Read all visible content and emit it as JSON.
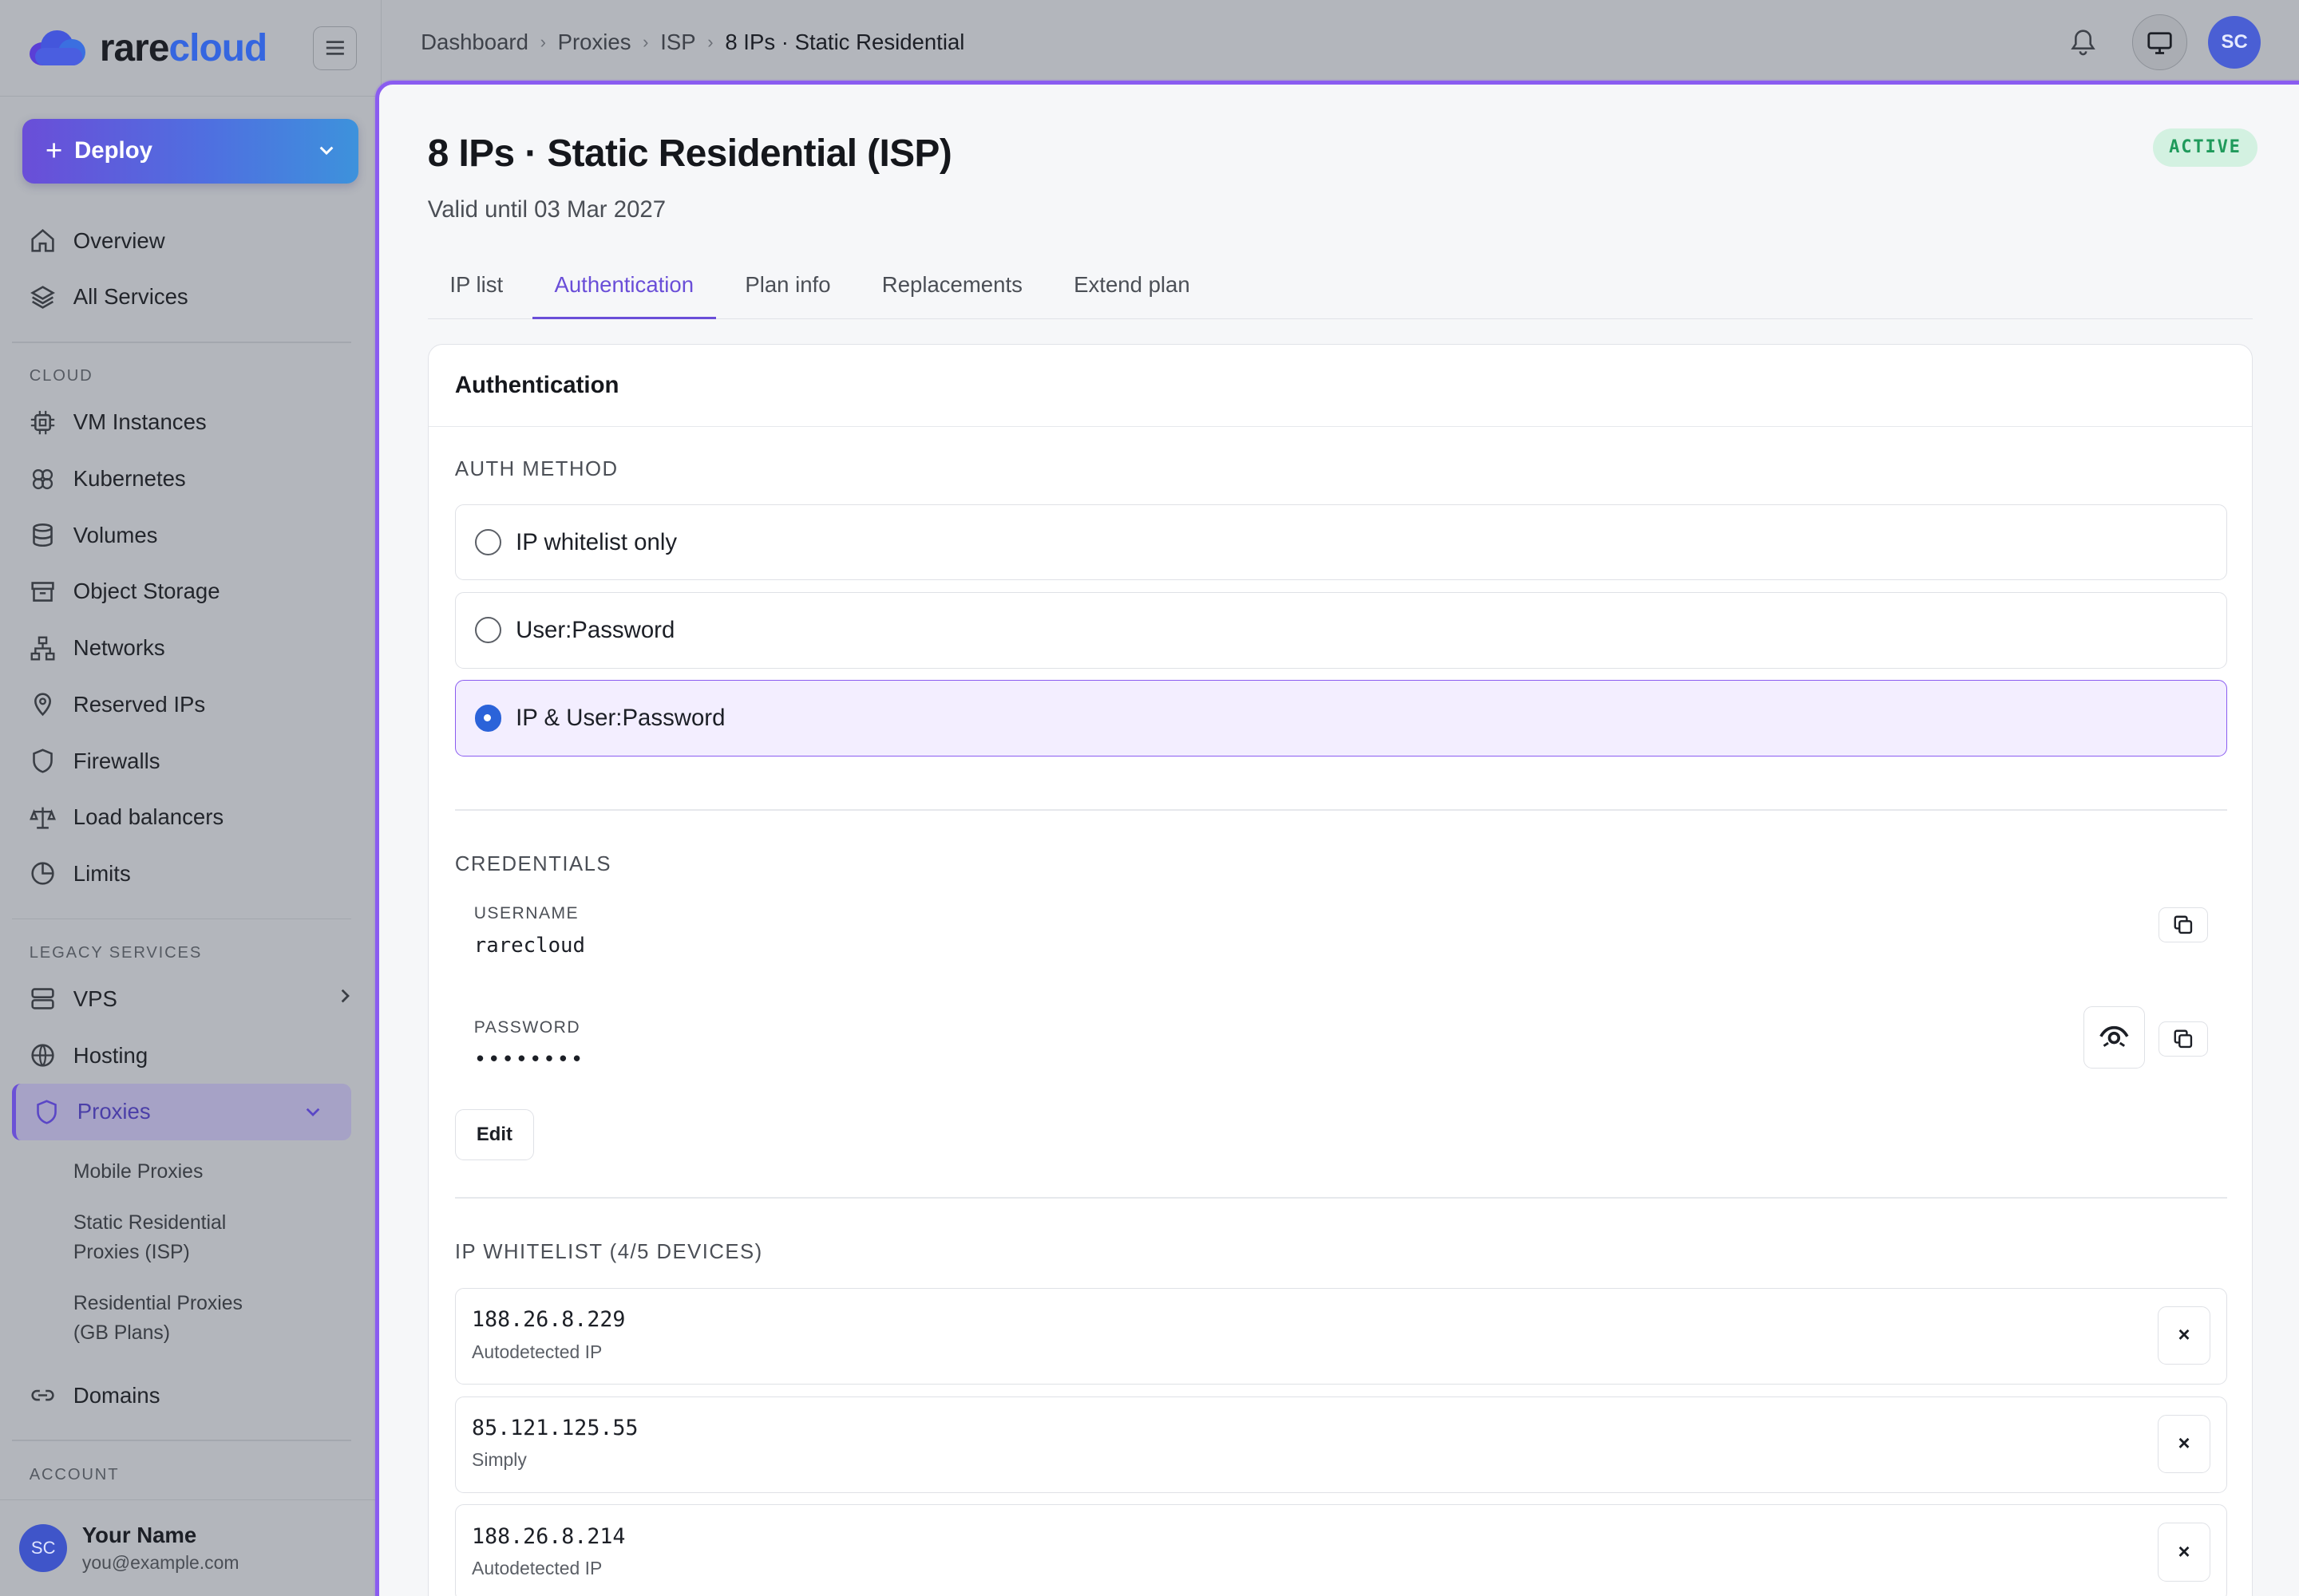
{
  "brand": {
    "name_part1": "rare",
    "name_part2": "cloud"
  },
  "sidebar": {
    "deploy_label": "Deploy",
    "top_items": [
      {
        "label": "Overview",
        "icon": "home-icon"
      },
      {
        "label": "All Services",
        "icon": "layers-icon"
      }
    ],
    "cloud_section": "CLOUD",
    "cloud_items": [
      {
        "label": "VM Instances",
        "icon": "cpu-icon"
      },
      {
        "label": "Kubernetes",
        "icon": "kubernetes-icon"
      },
      {
        "label": "Volumes",
        "icon": "database-icon"
      },
      {
        "label": "Object Storage",
        "icon": "archive-icon"
      },
      {
        "label": "Networks",
        "icon": "network-icon"
      },
      {
        "label": "Reserved IPs",
        "icon": "map-pin-icon"
      },
      {
        "label": "Firewalls",
        "icon": "shield-icon"
      },
      {
        "label": "Load balancers",
        "icon": "scale-icon"
      },
      {
        "label": "Limits",
        "icon": "pie-chart-icon"
      }
    ],
    "legacy_section": "LEGACY SERVICES",
    "legacy_items": [
      {
        "label": "VPS",
        "icon": "server-icon"
      },
      {
        "label": "Hosting",
        "icon": "globe-icon"
      },
      {
        "label": "Proxies",
        "icon": "shield-icon"
      }
    ],
    "proxies_sub": [
      "Mobile Proxies",
      "Static Residential Proxies (ISP)",
      "Residential Proxies (GB Plans)"
    ],
    "domains_label": "Domains",
    "account_section": "ACCOUNT",
    "account": {
      "initials": "SC",
      "name": "Your Name",
      "email": "you@example.com"
    }
  },
  "header": {
    "breadcrumbs": [
      "Dashboard",
      "Proxies",
      "ISP",
      "8 IPs · Static Residential"
    ],
    "avatar_initials": "SC"
  },
  "page": {
    "title": "8 IPs · Static Residential (ISP)",
    "subtitle": "Valid until 03 Mar 2027",
    "status": "ACTIVE",
    "tabs": [
      "IP list",
      "Authentication",
      "Plan info",
      "Replacements",
      "Extend plan"
    ],
    "active_tab": "Authentication"
  },
  "auth_card": {
    "heading": "Authentication",
    "auth_method_label": "AUTH METHOD",
    "options": [
      "IP whitelist only",
      "User:Password",
      "IP & User:Password"
    ],
    "selected_option": "IP & User:Password",
    "credentials_label": "CREDENTIALS",
    "username_label": "USERNAME",
    "username": "rarecloud",
    "password_label": "PASSWORD",
    "password_masked": "••••••••",
    "edit_label": "Edit",
    "whitelist_label": "IP WHITELIST (4/5 DEVICES)",
    "whitelist": [
      {
        "ip": "188.26.8.229",
        "note": "Autodetected IP"
      },
      {
        "ip": "85.121.125.55",
        "note": "Simply"
      },
      {
        "ip": "188.26.8.214",
        "note": "Autodetected IP"
      }
    ]
  },
  "colors": {
    "accent": "#6a4ed8",
    "status_bg": "#d3f1e1",
    "status_fg": "#1f9a5b",
    "radio_on": "#2b63d9"
  }
}
